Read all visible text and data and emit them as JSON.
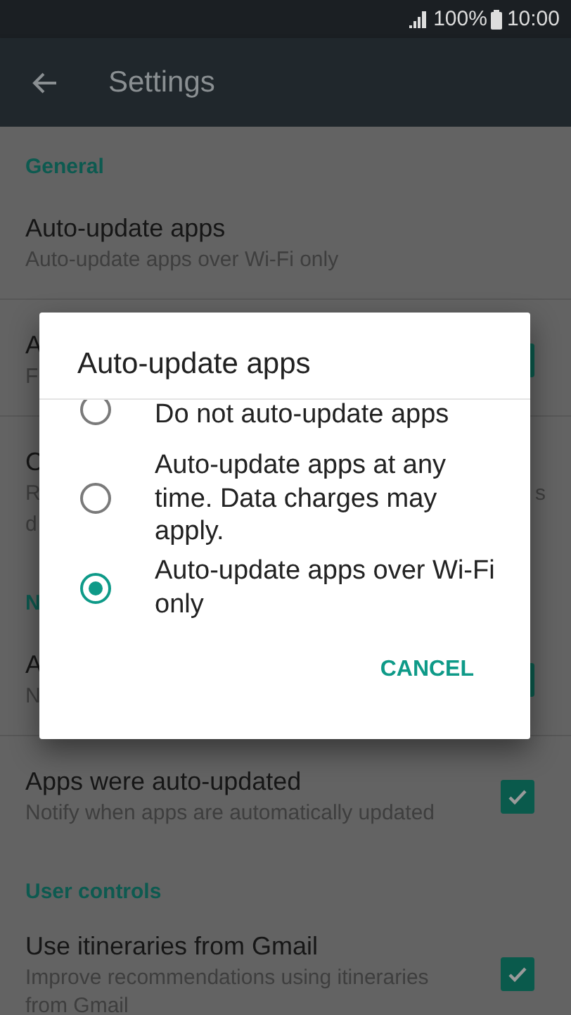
{
  "status_bar": {
    "battery": "100%",
    "time": "10:00"
  },
  "app_bar": {
    "title": "Settings"
  },
  "sections": [
    {
      "header": "General",
      "rows": [
        {
          "title": "Auto-update apps",
          "subtitle_lines": [
            "Auto-update apps over Wi-Fi only"
          ]
        },
        {
          "title": "A",
          "subtitle_lines": [
            "F"
          ],
          "checkbox_edge": true
        },
        {
          "title": "C",
          "subtitle_lines": [
            "R",
            "d"
          ],
          "subtitle_tail": "s"
        }
      ]
    },
    {
      "header": "N",
      "rows": [
        {
          "title": "A",
          "subtitle_lines": [
            "N"
          ],
          "checkbox_edge": true
        },
        {
          "title": "Apps were auto-updated",
          "subtitle_lines": [
            "Notify when apps are automatically updated"
          ],
          "checkbox": {
            "checked": true
          }
        }
      ]
    },
    {
      "header": "User controls",
      "rows": [
        {
          "title": "Use itineraries from Gmail",
          "subtitle_lines": [
            "Improve recommendations using itineraries",
            "from Gmail"
          ],
          "checkbox": {
            "checked": true
          }
        }
      ]
    }
  ],
  "dialog": {
    "title": "Auto-update apps",
    "options": [
      {
        "label": "Do not auto-update apps",
        "selected": false
      },
      {
        "label": "Auto-update apps at any time. Data charges may apply.",
        "selected": false
      },
      {
        "label": "Auto-update apps over Wi-Fi only",
        "selected": true
      }
    ],
    "buttons": [
      "CANCEL"
    ]
  }
}
